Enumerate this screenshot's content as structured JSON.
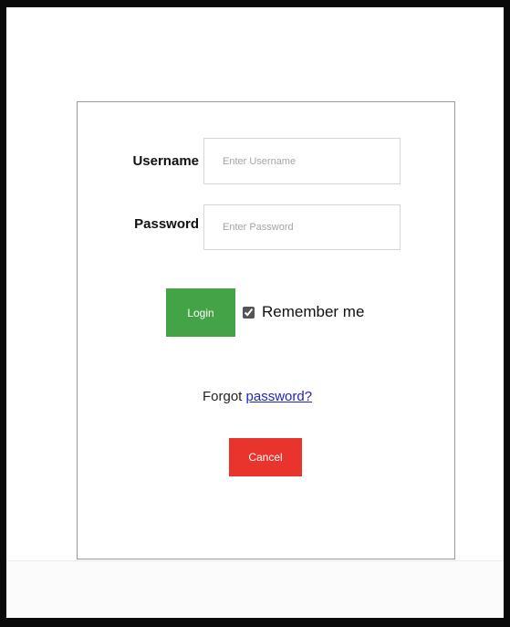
{
  "login_form": {
    "username": {
      "label": "Username",
      "placeholder": "Enter Username",
      "value": ""
    },
    "password": {
      "label": "Password",
      "placeholder": "Enter Password",
      "value": ""
    },
    "login_button_label": "Login",
    "remember_me": {
      "label": "Remember me",
      "checked": true
    },
    "forgot": {
      "prefix": "Forgot",
      "link_text": "password?"
    },
    "cancel_button_label": "Cancel"
  },
  "colors": {
    "login_button": "#43a447",
    "cancel_button": "#e8342d",
    "link": "#2222cc",
    "panel_border": "#9a9a9a"
  }
}
